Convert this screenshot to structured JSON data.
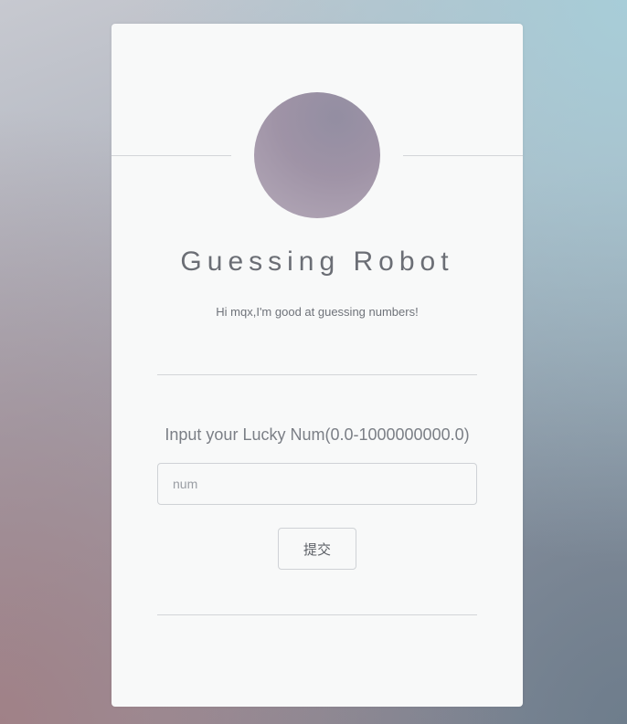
{
  "header": {
    "title": "Guessing Robot",
    "subtitle": "Hi mqx,I'm good at guessing numbers!"
  },
  "form": {
    "prompt": "Input your Lucky Num(0.0-1000000000.0)",
    "input_placeholder": "num",
    "input_value": "",
    "submit_label": "提交"
  },
  "colors": {
    "card_background": "#f8f9f9",
    "avatar": "#a195a8",
    "divider": "#d3d5d8"
  }
}
